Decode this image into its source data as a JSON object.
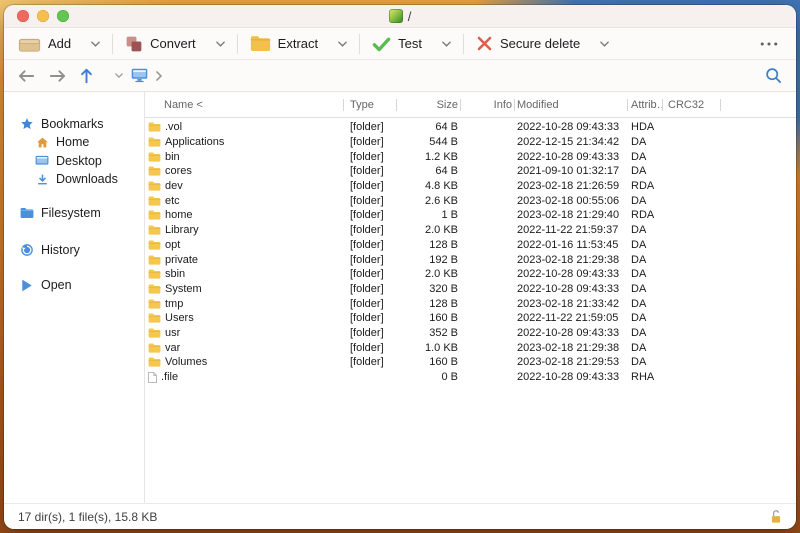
{
  "titlebar": {
    "title": "/"
  },
  "toolbar": {
    "buttons": [
      {
        "id": "add",
        "label": "Add"
      },
      {
        "id": "convert",
        "label": "Convert"
      },
      {
        "id": "extract",
        "label": "Extract"
      },
      {
        "id": "test",
        "label": "Test"
      },
      {
        "id": "secure-delete",
        "label": "Secure delete"
      }
    ]
  },
  "sidebar": {
    "bookmarks": "Bookmarks",
    "home": "Home",
    "desktop": "Desktop",
    "downloads": "Downloads",
    "filesystem": "Filesystem",
    "history": "History",
    "open": "Open"
  },
  "table": {
    "columns": {
      "name": "Name <",
      "type": "Type",
      "size": "Size",
      "info": "Info",
      "modified": "Modified",
      "attrib": "Attrib…",
      "crc32": "CRC32"
    },
    "rows": [
      {
        "icon": "folder",
        "name": ".vol",
        "type": "[folder]",
        "size": "64 B",
        "info": "",
        "modified": "2022-10-28 09:43:33",
        "attrib": "HDA",
        "crc32": ""
      },
      {
        "icon": "folder",
        "name": "Applications",
        "type": "[folder]",
        "size": "544 B",
        "info": "",
        "modified": "2022-12-15 21:34:42",
        "attrib": "DA",
        "crc32": ""
      },
      {
        "icon": "folder",
        "name": "bin",
        "type": "[folder]",
        "size": "1.2 KB",
        "info": "",
        "modified": "2022-10-28 09:43:33",
        "attrib": "DA",
        "crc32": ""
      },
      {
        "icon": "folder",
        "name": "cores",
        "type": "[folder]",
        "size": "64 B",
        "info": "",
        "modified": "2021-09-10 01:32:17",
        "attrib": "DA",
        "crc32": ""
      },
      {
        "icon": "folder",
        "name": "dev",
        "type": "[folder]",
        "size": "4.8 KB",
        "info": "",
        "modified": "2023-02-18 21:26:59",
        "attrib": "RDA",
        "crc32": ""
      },
      {
        "icon": "folder",
        "name": "etc",
        "type": "[folder]",
        "size": "2.6 KB",
        "info": "",
        "modified": "2023-02-18 00:55:06",
        "attrib": "DA",
        "crc32": ""
      },
      {
        "icon": "folder",
        "name": "home",
        "type": "[folder]",
        "size": "1 B",
        "info": "",
        "modified": "2023-02-18 21:29:40",
        "attrib": "RDA",
        "crc32": ""
      },
      {
        "icon": "folder",
        "name": "Library",
        "type": "[folder]",
        "size": "2.0 KB",
        "info": "",
        "modified": "2022-11-22 21:59:37",
        "attrib": "DA",
        "crc32": ""
      },
      {
        "icon": "folder",
        "name": "opt",
        "type": "[folder]",
        "size": "128 B",
        "info": "",
        "modified": "2022-01-16 11:53:45",
        "attrib": "DA",
        "crc32": ""
      },
      {
        "icon": "folder",
        "name": "private",
        "type": "[folder]",
        "size": "192 B",
        "info": "",
        "modified": "2023-02-18 21:29:38",
        "attrib": "DA",
        "crc32": ""
      },
      {
        "icon": "folder",
        "name": "sbin",
        "type": "[folder]",
        "size": "2.0 KB",
        "info": "",
        "modified": "2022-10-28 09:43:33",
        "attrib": "DA",
        "crc32": ""
      },
      {
        "icon": "folder",
        "name": "System",
        "type": "[folder]",
        "size": "320 B",
        "info": "",
        "modified": "2022-10-28 09:43:33",
        "attrib": "DA",
        "crc32": ""
      },
      {
        "icon": "folder",
        "name": "tmp",
        "type": "[folder]",
        "size": "128 B",
        "info": "",
        "modified": "2023-02-18 21:33:42",
        "attrib": "DA",
        "crc32": ""
      },
      {
        "icon": "folder",
        "name": "Users",
        "type": "[folder]",
        "size": "160 B",
        "info": "",
        "modified": "2022-11-22 21:59:05",
        "attrib": "DA",
        "crc32": ""
      },
      {
        "icon": "folder",
        "name": "usr",
        "type": "[folder]",
        "size": "352 B",
        "info": "",
        "modified": "2022-10-28 09:43:33",
        "attrib": "DA",
        "crc32": ""
      },
      {
        "icon": "folder",
        "name": "var",
        "type": "[folder]",
        "size": "1.0 KB",
        "info": "",
        "modified": "2023-02-18 21:29:38",
        "attrib": "DA",
        "crc32": ""
      },
      {
        "icon": "folder",
        "name": "Volumes",
        "type": "[folder]",
        "size": "160 B",
        "info": "",
        "modified": "2023-02-18 21:29:53",
        "attrib": "DA",
        "crc32": ""
      },
      {
        "icon": "file",
        "name": ".file",
        "type": "",
        "size": "0 B",
        "info": "",
        "modified": "2022-10-28 09:43:33",
        "attrib": "RHA",
        "crc32": ""
      }
    ]
  },
  "statusbar": {
    "summary": "17 dir(s), 1 file(s), 15.8 KB"
  },
  "colors": {
    "accent_blue": "#3d7ec4",
    "folder_yellow": "#f5c74f",
    "check_green": "#57bb4f",
    "delete_red": "#da604c",
    "convert_maroon": "#9d5353",
    "lock_yellow": "#e2b33c"
  }
}
